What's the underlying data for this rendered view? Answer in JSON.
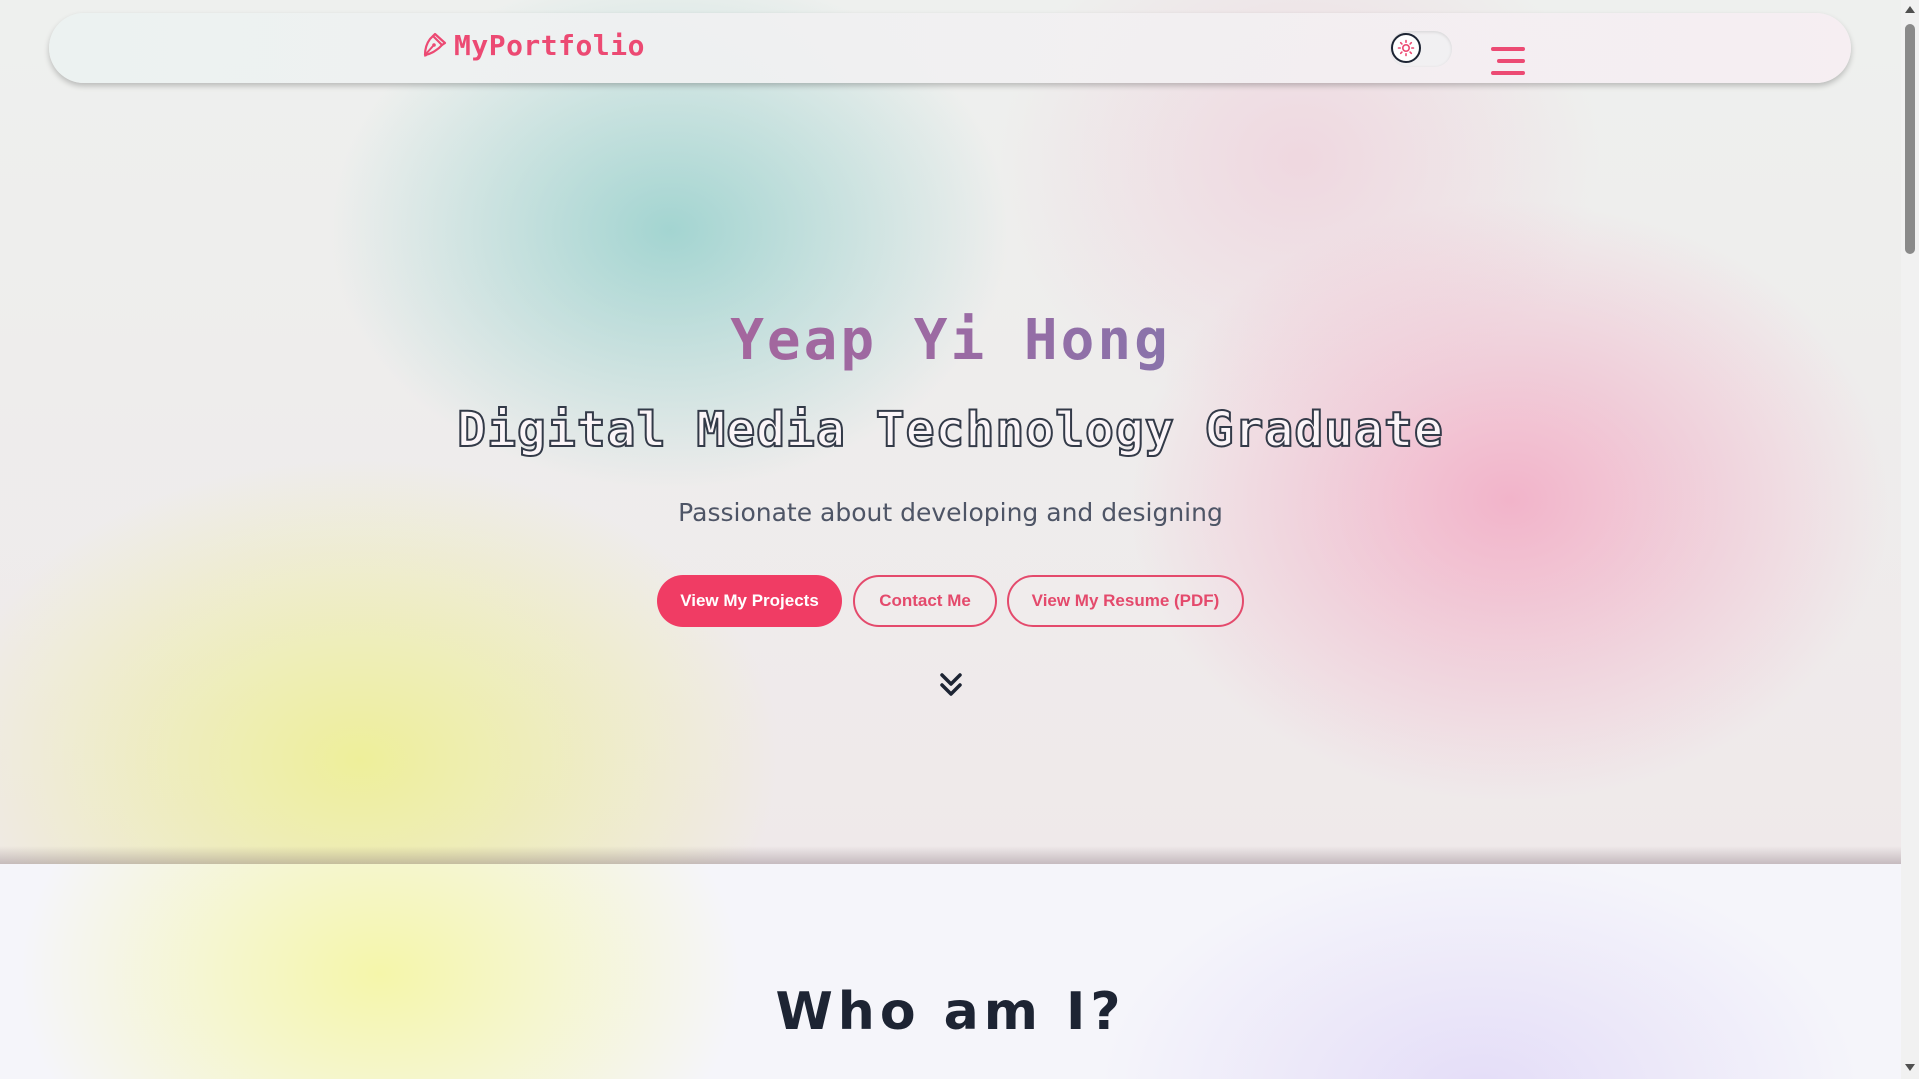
{
  "navbar": {
    "logo_text": "MyPortfolio",
    "logo_icon": "pen-nib-icon",
    "theme_toggle_icon": "sun-icon",
    "menu_icon": "hamburger-menu-icon"
  },
  "hero": {
    "name": "Yeap Yi Hong",
    "subtitle": "Digital Media Technology Graduate",
    "tagline": "Passionate about developing and designing",
    "buttons": {
      "projects": "View My Projects",
      "contact": "Contact Me",
      "resume": "View My Resume (PDF)"
    },
    "scroll_icon": "double-chevron-down-icon"
  },
  "about": {
    "title": "Who am I?"
  },
  "colors": {
    "accent": "#f03c64",
    "text_dark": "#1d2433",
    "text_muted": "#4e5566"
  }
}
